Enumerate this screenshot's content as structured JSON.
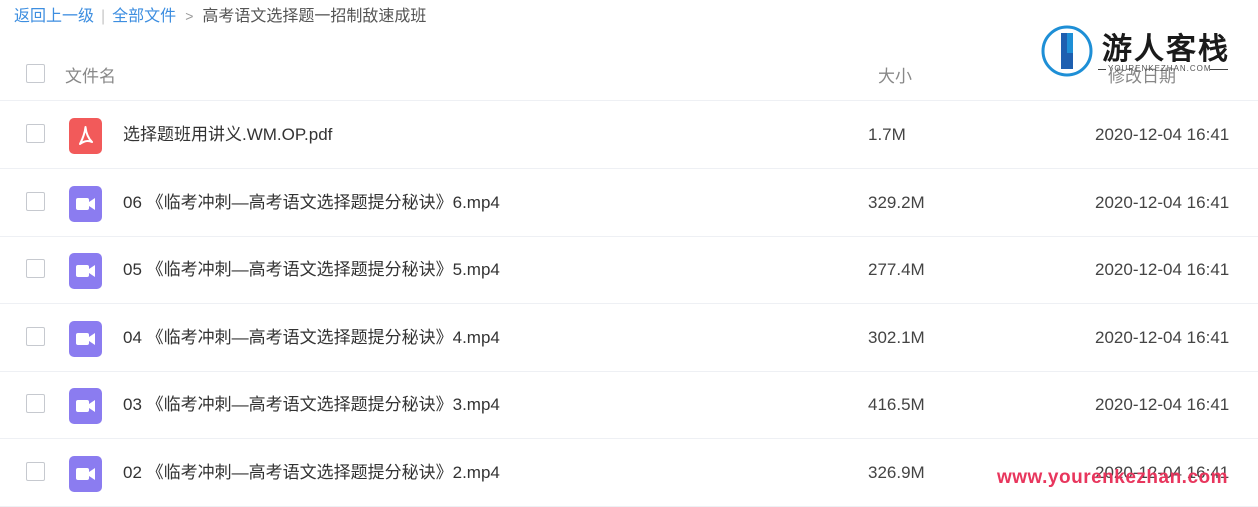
{
  "breadcrumb": {
    "back": "返回上一级",
    "separator": "|",
    "all_files": "全部文件",
    "arrow": ">",
    "current": "高考语文选择题一招制敌速成班"
  },
  "header": {
    "name": "文件名",
    "size": "大小",
    "date": "修改日期"
  },
  "files": [
    {
      "name": "选择题班用讲义.WM.OP.pdf",
      "size": "1.7M",
      "date": "2020-12-04 16:41",
      "type": "pdf"
    },
    {
      "name": "06 《临考冲刺—高考语文选择题提分秘诀》6.mp4",
      "size": "329.2M",
      "date": "2020-12-04 16:41",
      "type": "video"
    },
    {
      "name": "05 《临考冲刺—高考语文选择题提分秘诀》5.mp4",
      "size": "277.4M",
      "date": "2020-12-04 16:41",
      "type": "video"
    },
    {
      "name": "04 《临考冲刺—高考语文选择题提分秘诀》4.mp4",
      "size": "302.1M",
      "date": "2020-12-04 16:41",
      "type": "video"
    },
    {
      "name": "03 《临考冲刺—高考语文选择题提分秘诀》3.mp4",
      "size": "416.5M",
      "date": "2020-12-04 16:41",
      "type": "video"
    },
    {
      "name": "02 《临考冲刺—高考语文选择题提分秘诀》2.mp4",
      "size": "326.9M",
      "date": "2020-12-04 16:41",
      "type": "video"
    }
  ],
  "logo": {
    "brand": "游人客栈",
    "sub": "YOURENKEZHAN.COM"
  },
  "watermark": "www.yourenkezhan.com",
  "colors": {
    "link": "#3d8ee0",
    "pdf_icon": "#f25a5a",
    "video_icon": "#8b7cf0",
    "watermark": "#e8365d"
  }
}
